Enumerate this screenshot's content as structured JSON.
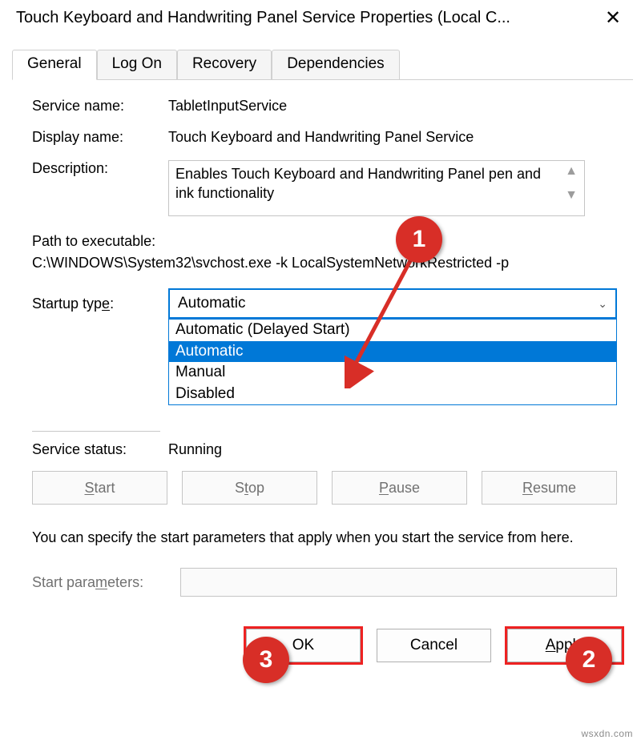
{
  "window": {
    "title": "Touch Keyboard and Handwriting Panel Service Properties (Local C..."
  },
  "tabs": {
    "general": "General",
    "logon": "Log On",
    "recovery": "Recovery",
    "dependencies": "Dependencies"
  },
  "labels": {
    "service_name": "Service name:",
    "display_name": "Display name:",
    "description": "Description:",
    "path": "Path to executable:",
    "startup_type_prefix": "Startup typ",
    "startup_type_und": "e",
    "startup_type_suffix": ":",
    "service_status": "Service status:",
    "start_params_prefix": "Start para",
    "start_params_und": "m",
    "start_params_suffix": "eters:"
  },
  "values": {
    "service_name": "TabletInputService",
    "display_name": "Touch Keyboard and Handwriting Panel Service",
    "description": "Enables Touch Keyboard and Handwriting Panel pen and ink functionality",
    "path": "C:\\WINDOWS\\System32\\svchost.exe -k LocalSystemNetworkRestricted -p",
    "service_status": "Running",
    "startup_selected": "Automatic"
  },
  "dropdown": {
    "opt_delayed": "Automatic (Delayed Start)",
    "opt_auto": "Automatic",
    "opt_manual": "Manual",
    "opt_disabled": "Disabled"
  },
  "svc_buttons": {
    "start_und": "S",
    "start_suffix": "tart",
    "stop_prefix": "S",
    "stop_und": "t",
    "stop_suffix": "op",
    "pause_und": "P",
    "pause_suffix": "ause",
    "resume_und": "R",
    "resume_suffix": "esume"
  },
  "hint": "You can specify the start parameters that apply when you start the service from here.",
  "bottom": {
    "ok": "OK",
    "cancel": "Cancel",
    "apply_und": "A",
    "apply_suffix": "pply"
  },
  "annotations": {
    "n1": "1",
    "n2": "2",
    "n3": "3"
  },
  "watermark": "wsxdn.com"
}
